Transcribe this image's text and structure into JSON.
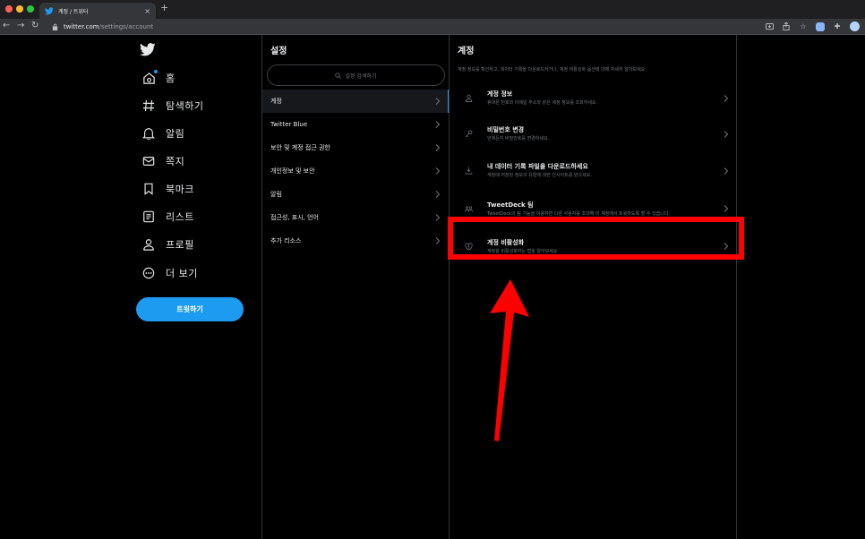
{
  "browser": {
    "tab_title": "계정 / 트위터",
    "tab_close": "×",
    "new_tab": "+",
    "url_host": "twitter.com",
    "url_path": "/settings/account",
    "icons": [
      "back-icon",
      "forward-icon",
      "reload-icon",
      "lock-icon",
      "share-icon",
      "star-icon",
      "extension-icon",
      "profile-avatar"
    ]
  },
  "nav": {
    "items": [
      {
        "label": "홈",
        "icon": "home-icon"
      },
      {
        "label": "탐색하기",
        "icon": "hashtag-icon"
      },
      {
        "label": "알림",
        "icon": "bell-icon"
      },
      {
        "label": "쪽지",
        "icon": "mail-icon"
      },
      {
        "label": "북마크",
        "icon": "bookmark-icon"
      },
      {
        "label": "리스트",
        "icon": "list-icon"
      },
      {
        "label": "프로필",
        "icon": "person-icon"
      },
      {
        "label": "더 보기",
        "icon": "more-icon"
      }
    ],
    "tweet_button": "트윗하기"
  },
  "settings": {
    "title": "설정",
    "search_placeholder": "설정 검색하기",
    "items": [
      {
        "label": "계정",
        "active": true
      },
      {
        "label": "Twitter Blue"
      },
      {
        "label": "보안 및 계정 접근 권한"
      },
      {
        "label": "개인정보 및 보안"
      },
      {
        "label": "알림"
      },
      {
        "label": "접근성, 표시, 언어"
      },
      {
        "label": "추가 리소스"
      }
    ]
  },
  "account": {
    "title": "계정",
    "description": "계정 정보를 확인하고, 데이터 기록을 다운로드하거나, 계정 비활성화 옵션에 대해 자세히 알아보세요.",
    "items": [
      {
        "title": "계정 정보",
        "subtitle": "휴대폰 번호와 이메일 주소와 같은 계정 정보를 조회하세요.",
        "icon": "person-icon"
      },
      {
        "title": "비밀번호 변경",
        "subtitle": "언제든지 비밀번호를 변경하세요.",
        "icon": "key-icon"
      },
      {
        "title": "내 데이터 기록 파일을 다운로드하세요",
        "subtitle": "계정에 저장된 정보의 유형에 대한 인사이트를 얻으세요.",
        "icon": "download-icon"
      },
      {
        "title": "TweetDeck 팀",
        "subtitle": "TweetDeck의 팀 기능을 이용하면 다른 사용자를 초대해 이 계정에서 트윗하도록 할 수 있습니다.",
        "icon": "team-icon"
      },
      {
        "title": "계정 비활성화",
        "subtitle": "계정을 비활성화하는 법을 알아보세요.",
        "icon": "broken-heart-icon"
      }
    ]
  },
  "colors": {
    "accent": "#1d9bf0",
    "highlight": "#ff0000",
    "background": "#000000"
  }
}
